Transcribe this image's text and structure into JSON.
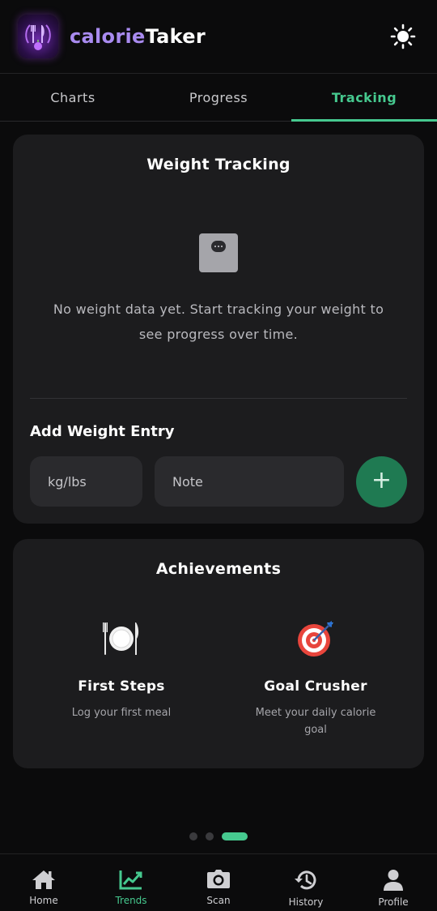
{
  "header": {
    "title_part1": "calorie",
    "title_part2": "Taker",
    "theme_icon": "sun-icon",
    "logo_icon": "fork-knife-logo-icon"
  },
  "tabs": [
    {
      "label": "Charts",
      "active": false
    },
    {
      "label": "Progress",
      "active": false
    },
    {
      "label": "Tracking",
      "active": true
    }
  ],
  "weight_tracking": {
    "title": "Weight Tracking",
    "empty_icon": "scale-icon",
    "empty_message": "No weight data yet. Start tracking your weight to see progress over time.",
    "add_entry_label": "Add Weight Entry",
    "weight_placeholder": "kg/lbs",
    "weight_value": "",
    "note_placeholder": "Note",
    "note_value": "",
    "add_button_label": "+"
  },
  "achievements": {
    "title": "Achievements",
    "items": [
      {
        "icon": "plate-cutlery-icon",
        "emoji": "🍽️",
        "name": "First Steps",
        "description": "Log your first meal"
      },
      {
        "icon": "target-icon",
        "emoji": "🎯",
        "name": "Goal Crusher",
        "description": "Meet your daily calorie goal"
      }
    ]
  },
  "pager": {
    "total": 3,
    "active_index": 2
  },
  "bottom_nav": [
    {
      "label": "Home",
      "icon": "home-icon",
      "active": false
    },
    {
      "label": "Trends",
      "icon": "trends-icon",
      "active": true
    },
    {
      "label": "Scan",
      "icon": "camera-icon",
      "active": false
    },
    {
      "label": "History",
      "icon": "history-icon",
      "active": false
    },
    {
      "label": "Profile",
      "icon": "profile-icon",
      "active": false
    }
  ],
  "colors": {
    "accent": "#46c98f",
    "brand_purple": "#a98bf0",
    "card_bg": "#1c1c1e",
    "page_bg": "#0b0b0c",
    "add_button_bg": "#1f7a52"
  }
}
